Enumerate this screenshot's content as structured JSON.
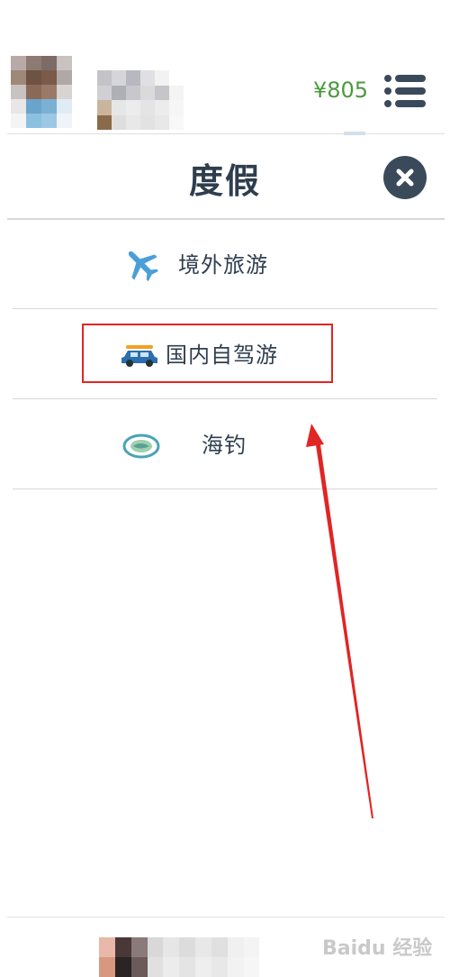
{
  "header": {
    "balance": "¥805",
    "menu_icon": "hamburger-list-icon"
  },
  "popup": {
    "title": "度假",
    "close_icon": "close-x-icon"
  },
  "menu": {
    "items": [
      {
        "label": "境外旅游",
        "icon": "airplane-icon",
        "icon_color": "#4a9fd8"
      },
      {
        "label": "国内自驾游",
        "icon": "car-icon",
        "icon_color": "#2a6fb0"
      },
      {
        "label": "海钓",
        "icon": "fishing-pond-icon",
        "icon_color": "#4aa3b8"
      }
    ]
  },
  "annotation": {
    "highlight_color": "#e02525",
    "arrow_color": "#e02525"
  },
  "watermark": {
    "text": "Baidu 经验"
  },
  "colors": {
    "balance": "#4a9a3e",
    "text": "#2f3e4e",
    "close_bg": "#3a4a5b"
  }
}
